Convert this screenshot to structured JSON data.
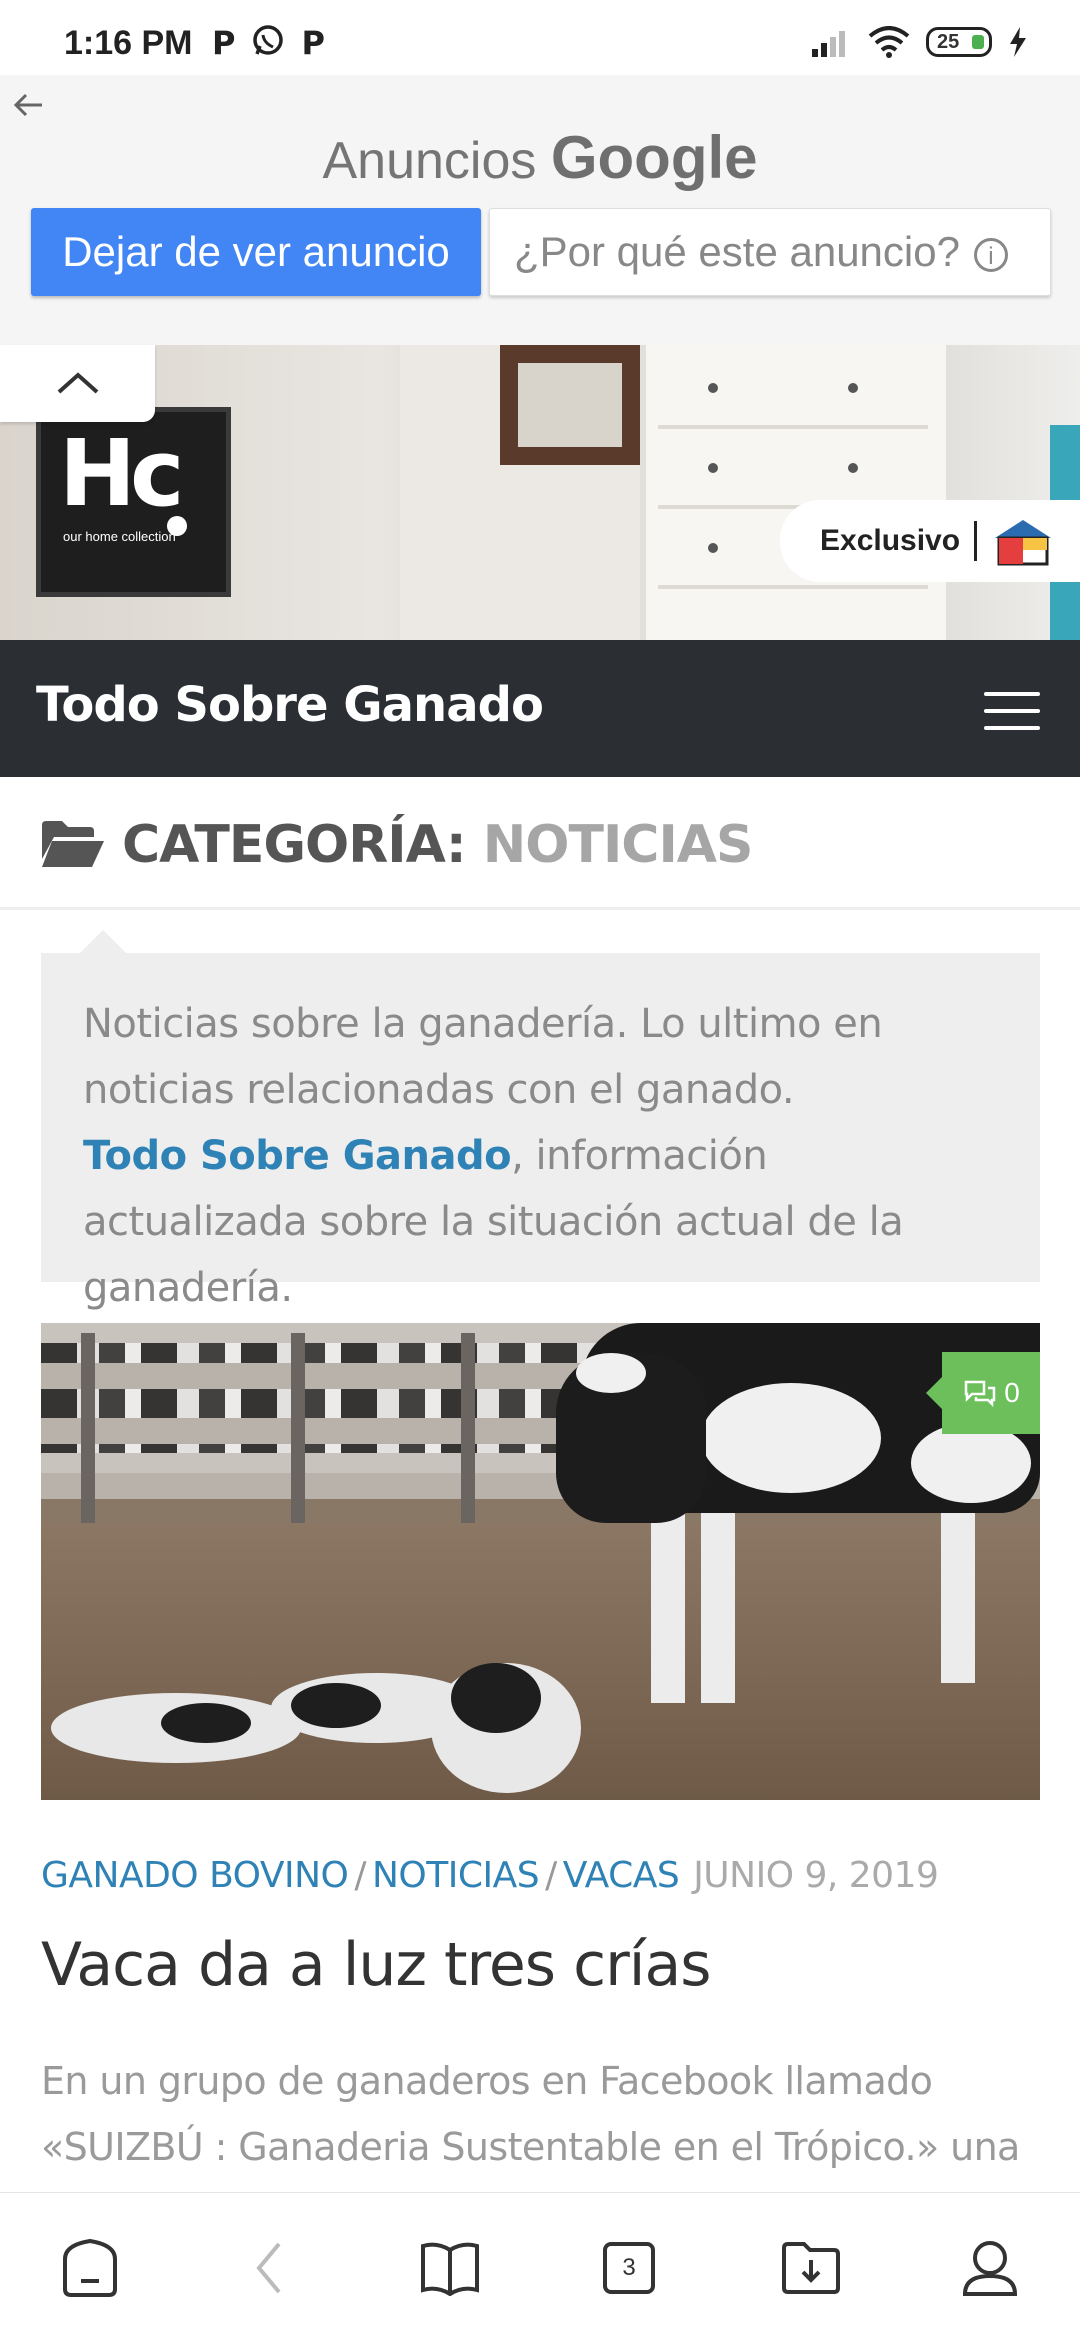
{
  "status_bar": {
    "time": "1:16 PM",
    "apps": [
      "P",
      "whatsapp-icon",
      "P"
    ],
    "battery": "25"
  },
  "ad_header": {
    "title_prefix": "Anuncios",
    "title_brand": "Google",
    "stop_button": "Dejar de ver anuncio",
    "why_button": "¿Por qué este anuncio?",
    "why_icon": "i"
  },
  "banner_ad": {
    "logo_text": "Hc",
    "logo_sub": "our home collection",
    "badge_text": "Exclusivo"
  },
  "site": {
    "title": "Todo Sobre Ganado"
  },
  "category": {
    "label": "CATEGORÍA:",
    "name": "NOTICIAS"
  },
  "description": {
    "line1": "Noticias sobre la ganadería. Lo ultimo en noticias relacionadas con el ganado.",
    "link": "Todo Sobre Ganado",
    "line2": ", información actualizada sobre la situación actual de la ganadería."
  },
  "article": {
    "comment_count": "0",
    "categories": [
      "GANADO BOVINO",
      "NOTICIAS",
      "VACAS"
    ],
    "separator": "/",
    "date": "JUNIO 9, 2019",
    "title": "Vaca da a luz tres crías",
    "excerpt": "En un grupo de ganaderos en Facebook llamado «SUIZBÚ : Ganaderia Sustentable en el Trópico.» una persona publicó"
  },
  "bottom_nav": {
    "tab_count": "3"
  }
}
